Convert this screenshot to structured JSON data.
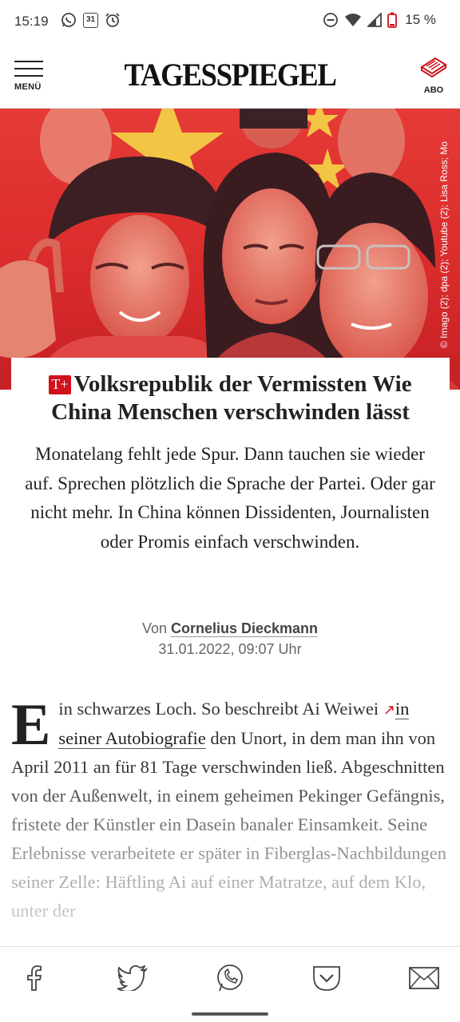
{
  "status_bar": {
    "time": "15:19",
    "calendar_day": "31",
    "battery": "15 %",
    "icons": [
      "whatsapp-icon",
      "calendar-icon",
      "alarm-icon",
      "do-not-disturb-icon",
      "wifi-icon",
      "signal-icon",
      "battery-icon"
    ]
  },
  "header": {
    "menu_label": "MENÜ",
    "logo": "TAGESSPIEGEL",
    "abo_label": "ABO"
  },
  "hero": {
    "credit": "© Imago (2); dpa (2); Youtube (2); Lisa Ross; Mo"
  },
  "article": {
    "badge": "T+",
    "kicker": "Volksrepublik der Vermissten",
    "headline": "Wie China Menschen verschwinden lässt",
    "teaser": "Monatelang fehlt jede Spur. Dann tauchen sie wieder auf. Sprechen plötzlich die Sprache der Partei. Oder gar nicht mehr. In China können Dissidenten, Journalisten oder Promis einfach verschwinden.",
    "byline_prefix": "Von",
    "author": "Cornelius Dieckmann",
    "date": "31.01.2022, 09:07 Uhr",
    "body_dropcap": "E",
    "body_start": "in schwarzes Loch. So beschreibt Ai Weiwei ",
    "body_link": "in seiner Autobiografie",
    "body_rest": " den Unort, in dem man ihn von April 2011 an für 81 Tage verschwinden ließ. Abgeschnitten von der Außenwelt, in einem geheimen Pekinger Gefängnis, fristete der Künstler ein Dasein banaler Einsamkeit. Seine Erlebnisse verarbeitete er später in Fiberglas-Nachbildungen seiner Zelle: Häftling Ai auf einer Matratze, auf dem Klo, unter der"
  },
  "share_bar": [
    "facebook-icon",
    "twitter-icon",
    "whatsapp-icon",
    "pocket-icon",
    "mail-icon"
  ],
  "colors": {
    "brand_red": "#d0111b",
    "hero_red": "#e53a36",
    "text": "#222222"
  }
}
